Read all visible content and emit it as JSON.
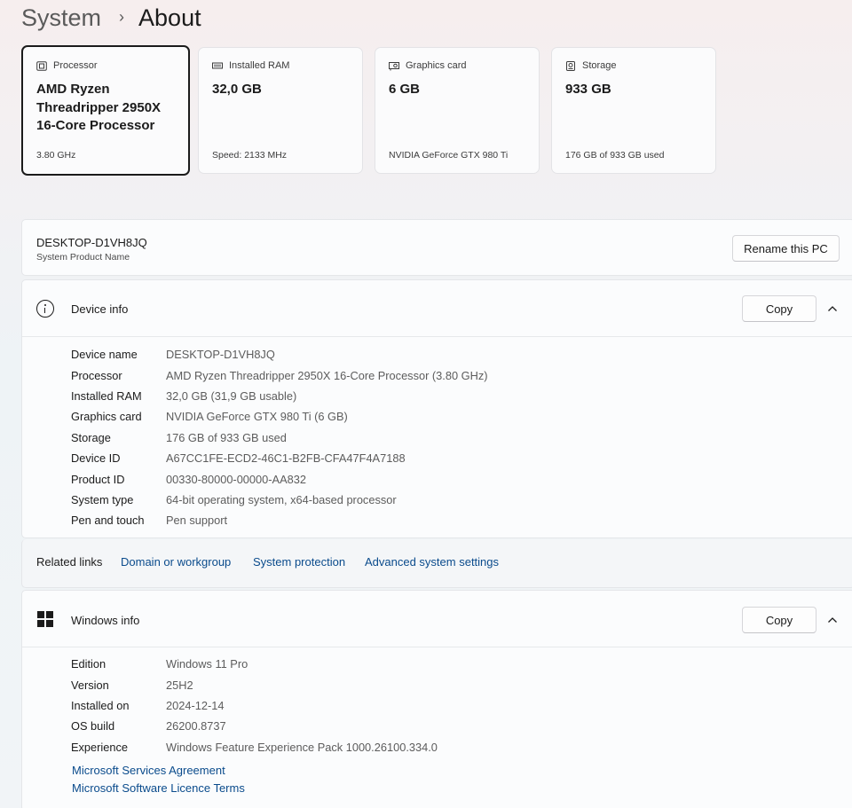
{
  "breadcrumb": {
    "parent": "System",
    "separator": "›",
    "current": "About"
  },
  "spec_cards": [
    {
      "title": "Processor",
      "icon": "processor-icon",
      "value": "AMD Ryzen Threadripper 2950X 16-Core Processor",
      "sub": "3.80 GHz"
    },
    {
      "title": "Installed RAM",
      "icon": "ram-icon",
      "value": "32,0 GB",
      "sub": "Speed: 2133 MHz"
    },
    {
      "title": "Graphics card",
      "icon": "graphics-card-icon",
      "value": "6 GB",
      "sub": "NVIDIA GeForce GTX 980 Ti"
    },
    {
      "title": "Storage",
      "icon": "storage-icon",
      "value": "933 GB",
      "sub": "176 GB of 933 GB used"
    }
  ],
  "pc": {
    "name": "DESKTOP-D1VH8JQ",
    "sub": "System Product Name",
    "rename_label": "Rename this PC"
  },
  "device_info": {
    "title": "Device info",
    "copy_label": "Copy",
    "rows": [
      {
        "k": "Device name",
        "v": "DESKTOP-D1VH8JQ"
      },
      {
        "k": "Processor",
        "v": "AMD Ryzen Threadripper 2950X 16-Core Processor (3.80 GHz)"
      },
      {
        "k": "Installed RAM",
        "v": "32,0 GB (31,9 GB usable)"
      },
      {
        "k": "Graphics card",
        "v": "NVIDIA GeForce GTX 980 Ti (6 GB)"
      },
      {
        "k": "Storage",
        "v": "176 GB of 933 GB used"
      },
      {
        "k": "Device ID",
        "v": "A67CC1FE-ECD2-46C1-B2FB-CFA47F4A7188"
      },
      {
        "k": "Product ID",
        "v": "00330-80000-00000-AA832"
      },
      {
        "k": "System type",
        "v": "64-bit operating system, x64-based processor"
      },
      {
        "k": "Pen and touch",
        "v": "Pen support"
      }
    ]
  },
  "related": {
    "label": "Related links",
    "links": [
      "Domain or workgroup",
      "System protection",
      "Advanced system settings"
    ]
  },
  "windows_info": {
    "title": "Windows info",
    "copy_label": "Copy",
    "rows": [
      {
        "k": "Edition",
        "v": "Windows 11 Pro"
      },
      {
        "k": "Version",
        "v": "25H2"
      },
      {
        "k": "Installed on",
        "v": "2024-12-14"
      },
      {
        "k": "OS build",
        "v": "26200.8737"
      },
      {
        "k": "Experience",
        "v": "Windows Feature Experience Pack 1000.26100.334.0"
      }
    ],
    "links": [
      "Microsoft Services Agreement",
      "Microsoft Software Licence Terms"
    ]
  }
}
